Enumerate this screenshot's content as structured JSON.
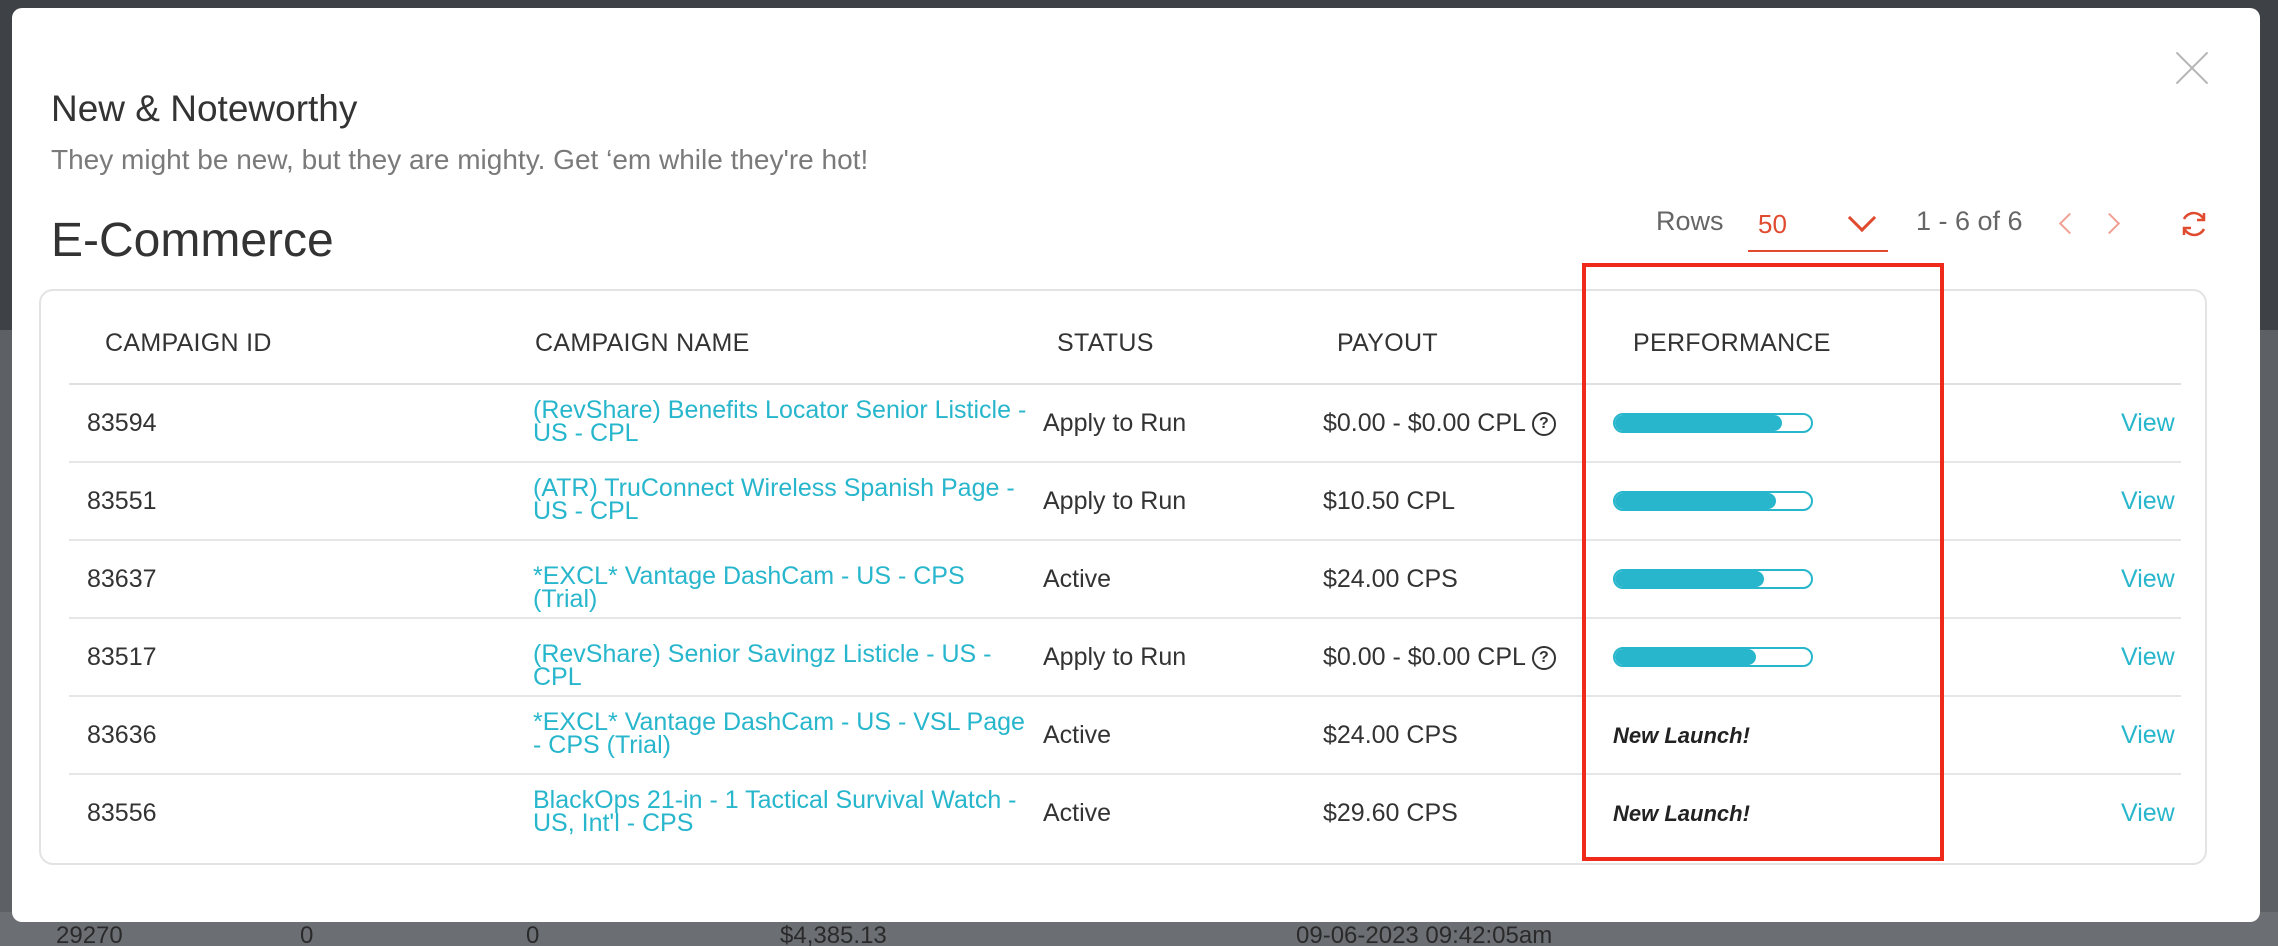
{
  "background_row": [
    "29270",
    "0",
    "0",
    "$4,385.13",
    "09-06-2023 09:42:05am"
  ],
  "modal": {
    "title": "New & Noteworthy",
    "subtitle": "They might be new, but they are mighty. Get ‘em while they're hot!",
    "section_title": "E-Commerce"
  },
  "pager": {
    "rows_label": "Rows",
    "rows_value": "50",
    "range": "1 - 6 of 6"
  },
  "table": {
    "headers": [
      "CAMPAIGN ID",
      "CAMPAIGN NAME",
      "STATUS",
      "PAYOUT",
      "PERFORMANCE"
    ],
    "rows": [
      {
        "id": "83594",
        "name": "(RevShare) Benefits Locator Senior Listicle - US - CPL",
        "status": "Apply to Run",
        "payout": "$0.00 - $0.00 CPL",
        "help": "?",
        "performance": 0.85,
        "perf_text": "",
        "view": "View"
      },
      {
        "id": "83551",
        "name": "(ATR) TruConnect Wireless Spanish Page - US - CPL",
        "status": "Apply to Run",
        "payout": "$10.50 CPL",
        "help": "",
        "performance": 0.82,
        "perf_text": "",
        "view": "View"
      },
      {
        "id": "83637",
        "name": "*EXCL* Vantage DashCam - US - CPS (Trial)",
        "status": "Active",
        "payout": "$24.00 CPS",
        "help": "",
        "performance": 0.76,
        "perf_text": "",
        "view": "View"
      },
      {
        "id": "83517",
        "name": "(RevShare) Senior Savingz Listicle - US - CPL",
        "status": "Apply to Run",
        "payout": "$0.00 - $0.00 CPL",
        "help": "?",
        "performance": 0.72,
        "perf_text": "",
        "view": "View"
      },
      {
        "id": "83636",
        "name": "*EXCL* Vantage DashCam - US - VSL Page - CPS (Trial)",
        "status": "Active",
        "payout": "$24.00 CPS",
        "help": "",
        "performance": null,
        "perf_text": "New Launch!",
        "view": "View"
      },
      {
        "id": "83556",
        "name": "BlackOps 21-in - 1 Tactical Survival Watch - US, Int'l - CPS",
        "status": "Active",
        "payout": "$29.60 CPS",
        "help": "",
        "performance": null,
        "perf_text": "New Launch!",
        "view": "View"
      }
    ]
  },
  "colors": {
    "accent": "#27b6cc",
    "pager_accent": "#e04a2f",
    "highlight": "#f02a1a"
  }
}
